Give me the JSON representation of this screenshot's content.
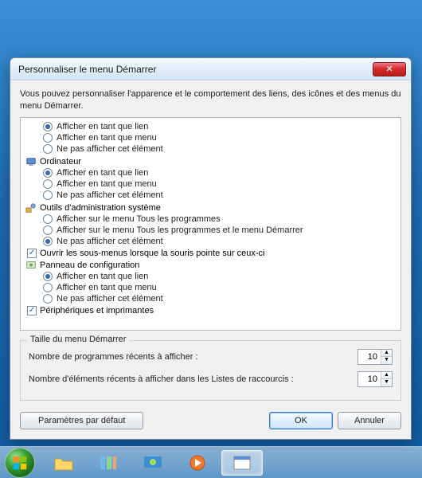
{
  "dialog": {
    "title": "Personnaliser le menu Démarrer",
    "intro": "Vous pouvez personnaliser l'apparence et le comportement des liens, des icônes et des menus du menu Démarrer.",
    "groups": [
      {
        "kind": "radio_options_no_header",
        "options": [
          {
            "label": "Afficher en tant que lien",
            "selected": true
          },
          {
            "label": "Afficher en tant que menu",
            "selected": false
          },
          {
            "label": "Ne pas afficher cet élément",
            "selected": false
          }
        ]
      },
      {
        "kind": "radio_group",
        "icon": "computer",
        "label": "Ordinateur",
        "options": [
          {
            "label": "Afficher en tant que lien",
            "selected": true
          },
          {
            "label": "Afficher en tant que menu",
            "selected": false
          },
          {
            "label": "Ne pas afficher cet élément",
            "selected": false
          }
        ]
      },
      {
        "kind": "radio_group",
        "icon": "tools",
        "label": "Outils d'administration système",
        "options": [
          {
            "label": "Afficher sur le menu Tous les programmes",
            "selected": false
          },
          {
            "label": "Afficher sur le menu Tous les programmes et le menu Démarrer",
            "selected": false
          },
          {
            "label": "Ne pas afficher cet élément",
            "selected": true
          }
        ]
      },
      {
        "kind": "checkbox",
        "checked": true,
        "label": "Ouvrir les sous-menus lorsque la souris pointe sur ceux-ci"
      },
      {
        "kind": "radio_group",
        "icon": "control_panel",
        "label": "Panneau de configuration",
        "options": [
          {
            "label": "Afficher en tant que lien",
            "selected": true
          },
          {
            "label": "Afficher en tant que menu",
            "selected": false
          },
          {
            "label": "Ne pas afficher cet élément",
            "selected": false
          }
        ]
      },
      {
        "kind": "checkbox",
        "checked": true,
        "label": "Périphériques et imprimantes"
      }
    ],
    "size_group": {
      "legend": "Taille du menu Démarrer",
      "recent_programs_label": "Nombre de programmes récents à afficher :",
      "recent_programs_value": 10,
      "jumplist_label": "Nombre d'éléments récents à afficher dans les Listes de raccourcis :",
      "jumplist_value": 10
    },
    "buttons": {
      "defaults": "Paramètres par défaut",
      "ok": "OK",
      "cancel": "Annuler"
    }
  },
  "taskbar": {
    "items": [
      "start",
      "explorer",
      "library",
      "media-center",
      "media-player",
      "dialog-window"
    ]
  }
}
